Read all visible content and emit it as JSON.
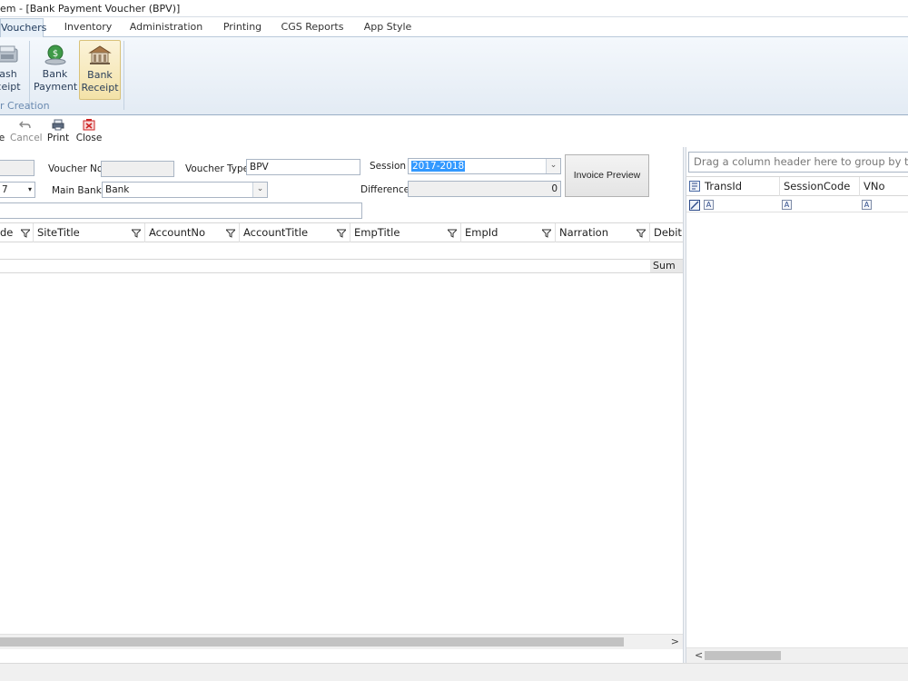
{
  "window": {
    "title": "em - [Bank Payment Voucher (BPV)]"
  },
  "tabs": [
    {
      "label": "Vouchers",
      "active": true
    },
    {
      "label": "Inventory"
    },
    {
      "label": "Administration"
    },
    {
      "label": "Printing"
    },
    {
      "label": "CGS Reports"
    },
    {
      "label": "App Style"
    }
  ],
  "ribbon": {
    "buttons": [
      {
        "line1": "ash",
        "line2": "ceipt",
        "icon": "cash-receipt-icon"
      },
      {
        "line1": "Bank",
        "line2": "Payment",
        "icon": "bank-payment-icon"
      },
      {
        "line1": "Bank",
        "line2": "Receipt",
        "icon": "bank-receipt-icon",
        "selected": true
      }
    ],
    "group_label": "r Creation"
  },
  "toolbar": {
    "save_label": "e",
    "cancel_label": "Cancel",
    "print_label": "Print",
    "close_label": "Close"
  },
  "form": {
    "voucher_no_label": "Voucher No",
    "voucher_no_value": "",
    "voucher_type_label": "Voucher Type",
    "voucher_type_value": "BPV",
    "session_label": "Session",
    "session_value": "2017-2018",
    "date_value": "7",
    "main_bank_label": "Main Bank",
    "main_bank_value": "Bank",
    "difference_label": "Difference",
    "difference_value": "0",
    "invoice_preview_label": "Invoice Preview",
    "narration_value": ""
  },
  "grid": {
    "columns": [
      "de",
      "SiteTitle",
      "AccountNo",
      "AccountTitle",
      "EmpTitle",
      "EmpId",
      "Narration",
      "Debit"
    ],
    "summary_label": "Sum",
    "scroll_right_glyph": ">"
  },
  "right_panel": {
    "group_hint": "Drag a column header here to group by t",
    "columns": [
      "TransId",
      "SessionCode",
      "VNo"
    ],
    "scroll_left_glyph": "<"
  },
  "colors": {
    "ribbon_bg": "#e3ebf4",
    "active_tab": "#e8f0f8",
    "selection": "#3399ff",
    "selected_button": "#f3e2a8",
    "cancel_icon": "#888888",
    "close_icon": "#cc2222"
  }
}
